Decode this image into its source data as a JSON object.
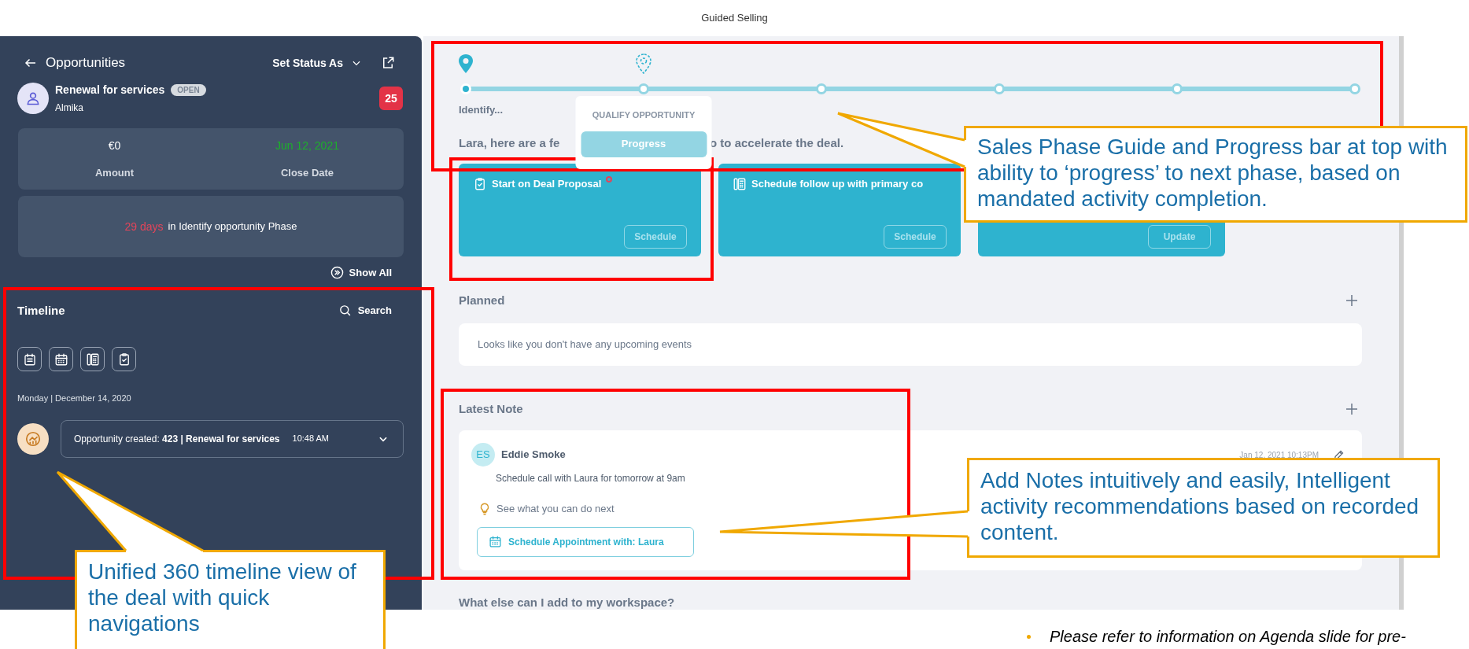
{
  "slide_title": "Guided Selling",
  "sidebar": {
    "back_label": "Opportunities",
    "status_menu": "Set Status As",
    "account": {
      "title": "Renewal for services",
      "status": "OPEN",
      "subtitle": "Almika",
      "badge": "25"
    },
    "stats": [
      {
        "value": "€0",
        "label": "Amount",
        "highlight": false
      },
      {
        "value": "Jun 12, 2021",
        "label": "Close Date",
        "highlight": true
      }
    ],
    "phase": {
      "days": "29 days",
      "text": "in Identify opportunity Phase"
    },
    "show_all": "Show All",
    "timeline": {
      "title": "Timeline",
      "search": "Search",
      "date": "Monday | December 14, 2020",
      "entries": [
        {
          "text": "Opportunity created: **423 | Renewal for services**",
          "time": "10:48 AM",
          "expanded": false
        }
      ]
    }
  },
  "workspace": {
    "stages": [
      {
        "label": "Identify...",
        "selected": true
      },
      {
        "selected": false,
        "popover": {
          "title": "QUALIFY OPPORTUNITY",
          "button": "Progress"
        }
      },
      {
        "selected": false
      },
      {
        "selected": false
      },
      {
        "selected": false
      },
      {
        "selected": false
      }
    ],
    "intro_parts": [
      "Lara, here are a fe",
      "o to accelerate the deal."
    ],
    "cards": [
      {
        "title": "Start on Deal Proposal",
        "required": true,
        "button": "Schedule"
      },
      {
        "title": "Schedule follow up with primary co",
        "required": false,
        "button": "Schedule"
      },
      {
        "button": "Update"
      }
    ],
    "planned": {
      "title": "Planned",
      "empty": "Looks like you don't have any upcoming events"
    },
    "latest_note": {
      "title": "Latest Note",
      "initials": "ES",
      "author": "Eddie Smoke",
      "body": "Schedule call with Laura for tomorrow at 9am",
      "date": "Jan 12, 2021 10:13PM",
      "hint": "See what you can do next",
      "action": "Schedule Appointment with: Laura"
    },
    "more": "What else can I add to my workspace?"
  },
  "annotations": [
    {
      "text": "Sales Phase Guide and Progress bar at top with ability to ‘progress’ to next phase, based on mandated activity completion."
    },
    {
      "text": "Add Notes intuitively and easily, Intelligent activity recommendations based on recorded content."
    },
    {
      "text": "Unified 360 timeline view of the deal with quick navigations"
    }
  ],
  "footnote": "Please refer to information on Agenda slide for pre-"
}
